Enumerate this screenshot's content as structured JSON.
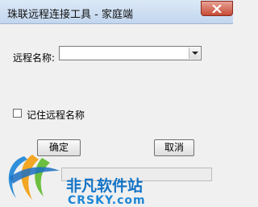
{
  "window": {
    "title": "珠联远程连接工具 - 家庭端",
    "close_icon": "close-icon"
  },
  "form": {
    "remote_name_label": "远程名称:",
    "remote_name_value": "",
    "remember_label": "记住远程名称",
    "remember_checked": false
  },
  "buttons": {
    "ok_label": "确定",
    "cancel_label": "取消"
  },
  "status": {
    "progress": 0
  },
  "watermark": {
    "line1": "非凡软件站",
    "line2": "CRSKY.com"
  },
  "colors": {
    "titlebar": "#c2d6ee",
    "close_button": "#c74a36",
    "watermark_blue": "#1273c6"
  }
}
